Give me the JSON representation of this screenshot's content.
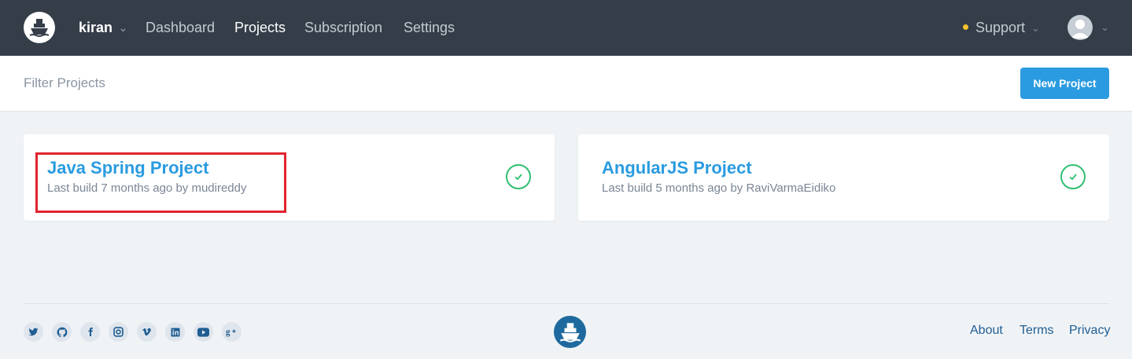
{
  "nav": {
    "user": "kiran",
    "items": [
      {
        "label": "Dashboard"
      },
      {
        "label": "Projects"
      },
      {
        "label": "Subscription"
      },
      {
        "label": "Settings"
      }
    ],
    "support": "Support"
  },
  "filter": {
    "placeholder": "Filter Projects"
  },
  "new_project_label": "New Project",
  "projects": [
    {
      "title": "Java Spring Project",
      "meta": "Last build 7 months ago by mudireddy",
      "status": "success"
    },
    {
      "title": "AngularJS Project",
      "meta": "Last build 5 months ago by RaviVarmaEidiko",
      "status": "success"
    }
  ],
  "footer": {
    "social": [
      "twitter",
      "github",
      "facebook",
      "instagram",
      "vimeo",
      "linkedin",
      "youtube",
      "google-plus"
    ],
    "links": [
      {
        "label": "About"
      },
      {
        "label": "Terms"
      },
      {
        "label": "Privacy"
      }
    ]
  },
  "colors": {
    "nav_bg": "#343d48",
    "accent": "#2a9be0",
    "success": "#2fbf71",
    "highlight": "#e1232d"
  }
}
